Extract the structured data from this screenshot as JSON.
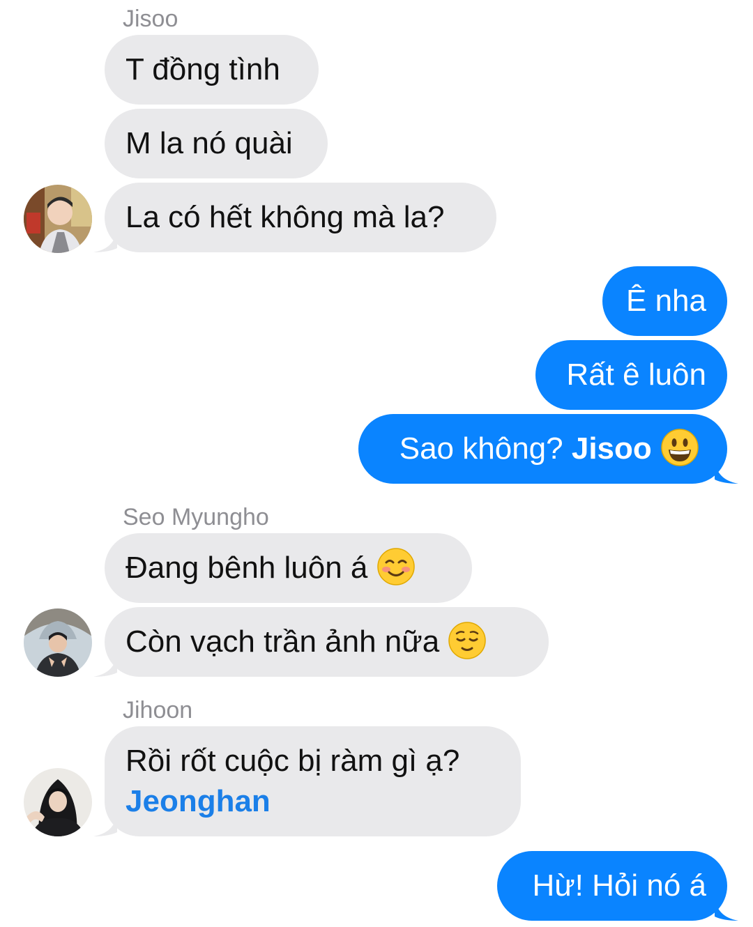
{
  "conversation": {
    "groups": [
      {
        "sender": "Jisoo",
        "messages": [
          "T đồng tình",
          "M la nó quài",
          "La có hết không mà la?"
        ]
      },
      {
        "sender": "me",
        "messages": [
          "Ê nha",
          "Rất ê luôn",
          "Sao không?"
        ],
        "mention": "Jisoo",
        "emoji": "grinning-face-emoji"
      },
      {
        "sender": "Seo Myungho",
        "messages": [
          "Đang bênh luôn á",
          "Còn vạch trần ảnh nữa"
        ],
        "emojis": [
          "smiling-face-emoji",
          "relieved-face-emoji"
        ]
      },
      {
        "sender": "Jihoon",
        "messages": [
          "Rồi rốt cuộc bị ràm gì ạ?"
        ],
        "mention": "Jeonghan"
      },
      {
        "sender": "me",
        "messages": [
          "Hừ! Hỏi nó á"
        ]
      }
    ]
  },
  "colors": {
    "incoming_bubble": "#e9e9eb",
    "outgoing_bubble": "#0a84ff",
    "sender_name": "#8e8e93",
    "mention": "#1b7fe8"
  }
}
